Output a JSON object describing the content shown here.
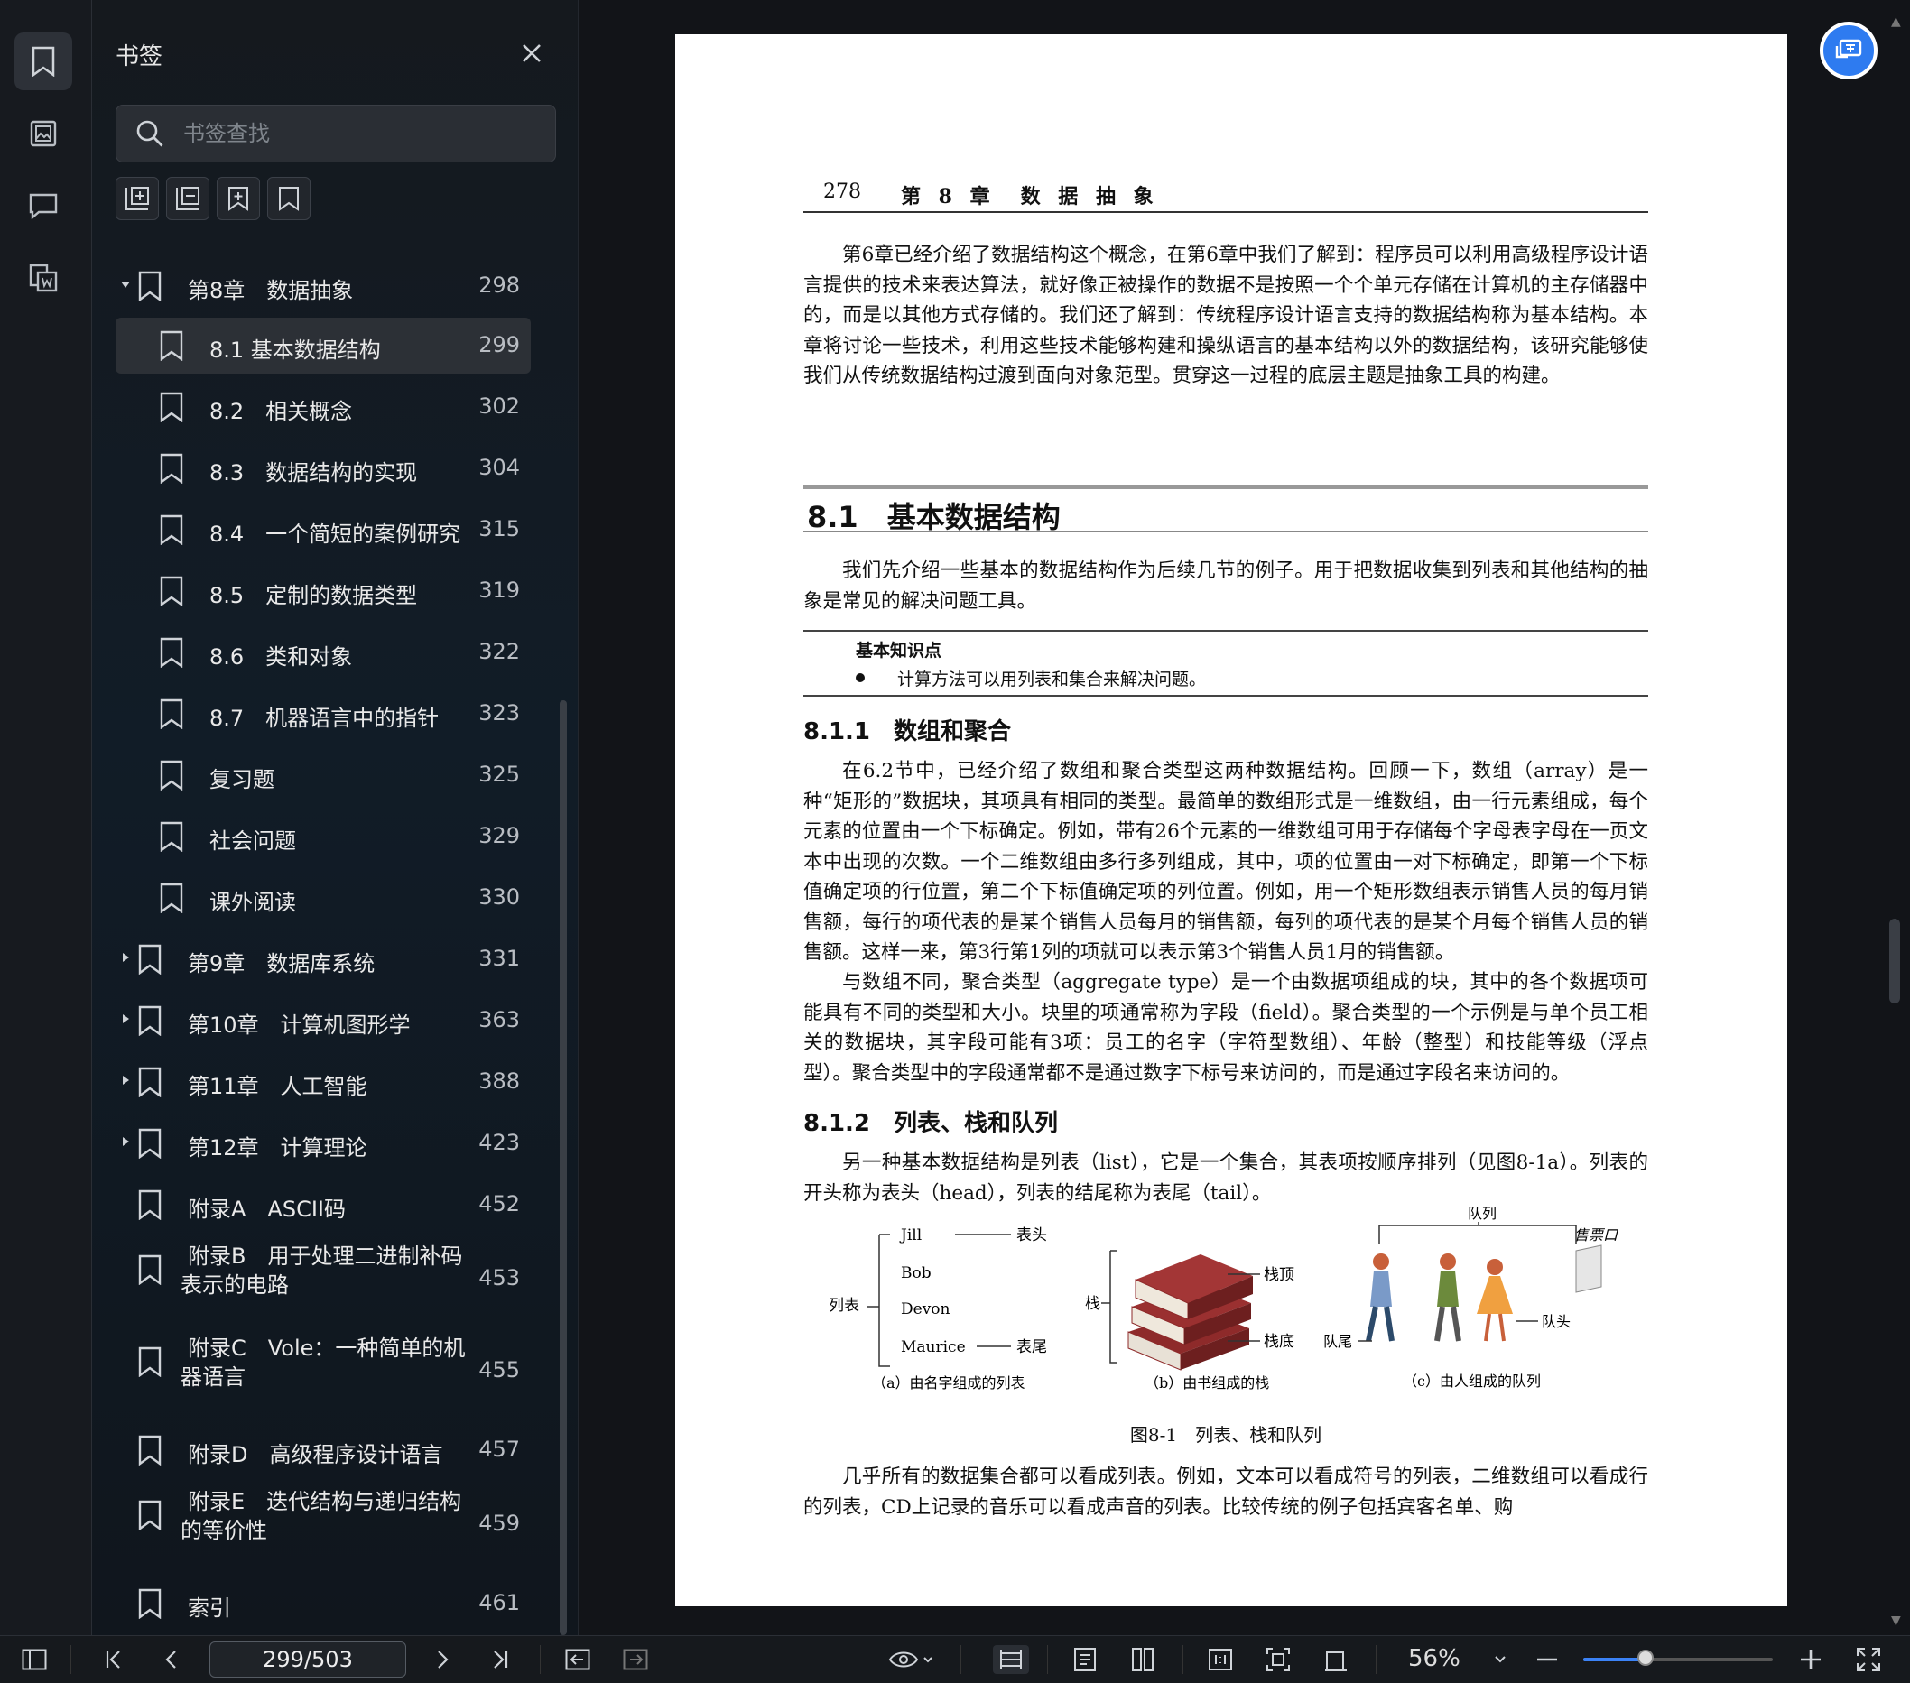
{
  "sidebar": {
    "title": "书签",
    "search_placeholder": "书签查找",
    "items": [
      {
        "label": "第8章　数据抽象",
        "page": "298",
        "level": 0,
        "arrow": "down"
      },
      {
        "label": "8.1 基本数据结构",
        "page": "299",
        "level": 1,
        "selected": true
      },
      {
        "label": "8.2　相关概念",
        "page": "302",
        "level": 1
      },
      {
        "label": "8.3　数据结构的实现",
        "page": "304",
        "level": 1
      },
      {
        "label": "8.4　一个简短的案例研究",
        "page": "315",
        "level": 1
      },
      {
        "label": "8.5　定制的数据类型",
        "page": "319",
        "level": 1
      },
      {
        "label": "8.6　类和对象",
        "page": "322",
        "level": 1
      },
      {
        "label": "8.7　机器语言中的指针",
        "page": "323",
        "level": 1
      },
      {
        "label": "复习题",
        "page": "325",
        "level": 1
      },
      {
        "label": "社会问题",
        "page": "329",
        "level": 1
      },
      {
        "label": "课外阅读",
        "page": "330",
        "level": 1
      },
      {
        "label": "第9章　数据库系统",
        "page": "331",
        "level": 0,
        "arrow": "right"
      },
      {
        "label": "第10章　计算机图形学",
        "page": "363",
        "level": 0,
        "arrow": "right"
      },
      {
        "label": "第11章　人工智能",
        "page": "388",
        "level": 0,
        "arrow": "right"
      },
      {
        "label": "第12章　计算理论",
        "page": "423",
        "level": 0,
        "arrow": "right"
      },
      {
        "label": "附录A　ASCII码",
        "page": "452",
        "level": 0
      },
      {
        "label": "附录B　用于处理二进制补码",
        "label2": "表示的电路",
        "page": "453",
        "level": 0
      },
      {
        "label": "附录C　Vole：一种简单的机",
        "label2": "器语言",
        "page": "455",
        "level": 0
      },
      {
        "label": "附录D　高级程序设计语言",
        "page": "457",
        "level": 0
      },
      {
        "label": "附录E　迭代结构与递归结构",
        "label2": "的等价性",
        "page": "459",
        "level": 0
      },
      {
        "label": "索引",
        "page": "461",
        "level": 0
      }
    ]
  },
  "document": {
    "page_number": "278",
    "running_title": "第 8 章　数 据 抽 象",
    "intro": "第6章已经介绍了数据结构这个概念，在第6章中我们了解到：程序员可以利用高级程序设计语言提供的技术来表达算法，就好像正被操作的数据不是按照一个个单元存储在计算机的主存储器中的，而是以其他方式存储的。我们还了解到：传统程序设计语言支持的数据结构称为基本结构。本章将讨论一些技术，利用这些技术能够构建和操纵语言的基本结构以外的数据结构，该研究能够使我们从传统数据结构过渡到面向对象范型。贯穿这一过程的底层主题是抽象工具的构建。",
    "section_title": "8.1　基本数据结构",
    "section_intro": "我们先介绍一些基本的数据结构作为后续几节的例子。用于把数据收集到列表和其他结构的抽象是常见的解决问题工具。",
    "knowledge_title": "基本知识点",
    "knowledge_item": "计算方法可以用列表和集合来解决问题。",
    "sub1_title": "8.1.1　数组和聚合",
    "sub1_p1": "在6.2节中，已经介绍了数组和聚合类型这两种数据结构。回顾一下，数组（array）是一种“矩形的”数据块，其项具有相同的类型。最简单的数组形式是一维数组，由一行元素组成，每个元素的位置由一个下标确定。例如，带有26个元素的一维数组可用于存储每个字母表字母在一页文本中出现的次数。一个二维数组由多行多列组成，其中，项的位置由一对下标确定，即第一个下标值确定项的行位置，第二个下标值确定项的列位置。例如，用一个矩形数组表示销售人员的每月销售额，每行的项代表的是某个销售人员每月的销售额，每列的项代表的是某个月每个销售人员的销售额。这样一来，第3行第1列的项就可以表示第3个销售人员1月的销售额。",
    "sub1_p2": "与数组不同，聚合类型（aggregate type）是一个由数据项组成的块，其中的各个数据项可能具有不同的类型和大小。块里的项通常称为字段（field）。聚合类型的一个示例是与单个员工相关的数据块，其字段可能有3项：员工的名字（字符型数组）、年龄（整型）和技能等级（浮点型）。聚合类型中的字段通常都不是通过数字下标号来访问的，而是通过字段名来访问的。",
    "sub2_title": "8.1.2　列表、栈和队列",
    "sub2_p1": "另一种基本数据结构是列表（list），它是一个集合，其表项按顺序排列（见图8-1a）。列表的开头称为表头（head），列表的结尾称为表尾（tail）。",
    "figure": {
      "list_label": "列表",
      "list_names": [
        "Jill",
        "Bob",
        "Devon",
        "Maurice"
      ],
      "list_head": "表头",
      "list_tail": "表尾",
      "cap_a": "（a）由名字组成的列表",
      "stack_label": "栈",
      "stack_top": "栈顶",
      "stack_bottom": "栈底",
      "cap_b": "（b）由书组成的栈",
      "queue_label": "队列",
      "queue_window": "售票口",
      "queue_tail": "队尾",
      "queue_head": "队头",
      "cap_c": "（c）由人组成的队列",
      "caption": "图8-1　列表、栈和队列"
    },
    "final_p": "几乎所有的数据集合都可以看成列表。例如，文本可以看成符号的列表，二维数组可以看成行的列表，CD上记录的音乐可以看成声音的列表。比较传统的例子包括宾客名单、购"
  },
  "toolbar": {
    "page_indicator": "299/503",
    "zoom": "56%",
    "zoom_fraction": 0.33
  },
  "colors": {
    "accent": "#2e7bf0",
    "slider_fill": "#3b82f6",
    "selected_row": "#2c3036"
  }
}
